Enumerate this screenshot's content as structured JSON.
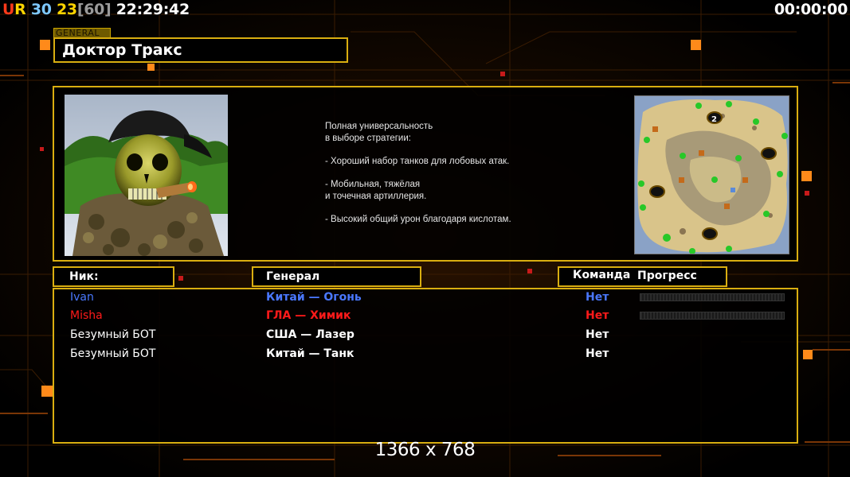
{
  "hud": {
    "left": [
      {
        "text": "U",
        "color": "#ff3a1a"
      },
      {
        "text": "R",
        "color": "#ffd400"
      },
      {
        "text": " ",
        "color": "#ffffff"
      },
      {
        "text": "30",
        "color": "#7ec8ff"
      },
      {
        "text": " ",
        "color": "#ffffff"
      },
      {
        "text": "23",
        "color": "#ffd400"
      },
      {
        "text": "[60]",
        "color": "#9a9a9a"
      },
      {
        "text": " 22:29:42",
        "color": "#ffffff"
      }
    ],
    "right": "00:00:00"
  },
  "general": {
    "tag": "GENERAL",
    "name": "Доктор Тракс",
    "description": "Полная универсальность\nв выборе стратегии:\n\n- Хороший набор танков для лобовых атак.\n\n- Мобильная, тяжёлая\nи точечная артиллерия.\n\n- Высокий общий урон благодаря кислотам."
  },
  "columns": {
    "nick": "Ник:",
    "general": "Генерал",
    "team": "Команда",
    "progress": "Прогресс"
  },
  "players": [
    {
      "nick": "Ivan",
      "general": "Китай — Огонь",
      "team": "Нет",
      "color": "#4a78ff",
      "progress": 0
    },
    {
      "nick": "Misha",
      "general": "ГЛА — Химик",
      "team": "Нет",
      "color": "#ff1a1a",
      "progress": 0
    },
    {
      "nick": "Безумный БОТ",
      "general": "США — Лазер",
      "team": "Нет",
      "color": "#ffffff",
      "progress": null
    },
    {
      "nick": "Безумный БОТ",
      "general": "Китай — Танк",
      "team": "Нет",
      "color": "#ffffff",
      "progress": null
    }
  ],
  "minimap": {
    "start_marker": "2"
  },
  "resolution": "1366 x 768",
  "theme": {
    "accent": "#d9ae10",
    "accent_dark": "#6e5a00",
    "background": "#000000",
    "grid_line": "#3a1a00"
  }
}
